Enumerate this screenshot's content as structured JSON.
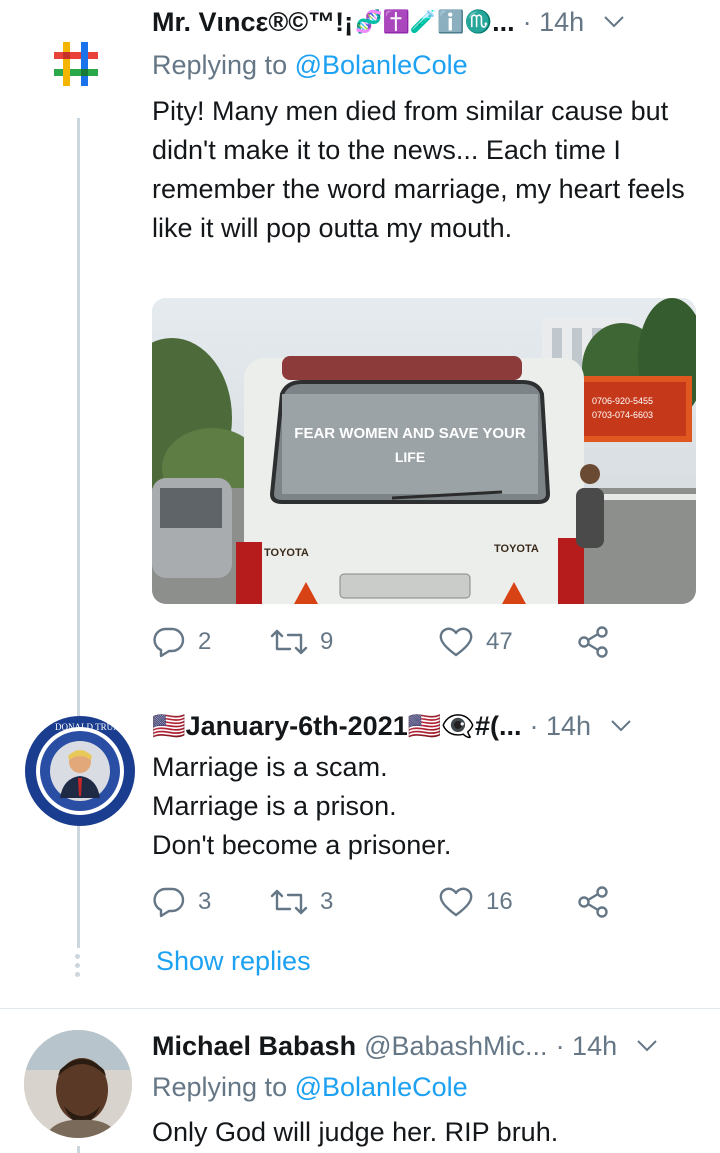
{
  "tweets": [
    {
      "name": "Mr. Vιncε®©™!¡",
      "name_emoji": "🧬✝️🧪ℹ️♏",
      "name_ellipsis": "...",
      "time": "· 14h",
      "replying_label": "Replying to",
      "replying_mention": "@BolanleCole",
      "text": "Pity! Many men died from similar cause but didn't make it to the news... Each time I remember the word marriage, my heart feels like it will pop outta my mouth.",
      "photo": {
        "sign_text_line1": "FEAR WOMEN AND SAVE YOUR",
        "sign_text_line2": "LIFE",
        "brand_left": "TOYOTA",
        "brand_right": "TOYOTA",
        "billboard_line1": "0706-920-5455",
        "billboard_line2": "0703-074-6603"
      },
      "replies": "2",
      "retweets": "9",
      "likes": "47"
    },
    {
      "name": "🇺🇸January-6th-2021🇺🇸👁‍🗨#(...",
      "time": "· 14h",
      "avatar_ring_text": "DONALD TRUMP",
      "text": "Marriage is a scam.\nMarriage is a prison.\nDon't become a prisoner.",
      "replies": "3",
      "retweets": "3",
      "likes": "16",
      "show_replies": "Show replies"
    },
    {
      "name": "Michael Babash",
      "handle": "@BabashMic...",
      "time": "· 14h",
      "replying_label": "Replying to",
      "replying_mention": "@BolanleCole",
      "text": "Only God will judge her. RIP bruh."
    }
  ],
  "colors": {
    "text": "#14171a",
    "secondary": "#657786",
    "accent": "#1da1f2",
    "thread_line": "#ccd6dd"
  },
  "icons": [
    "hashtag-avatar-icon",
    "chevron-down-icon",
    "reply-icon",
    "retweet-icon",
    "like-icon",
    "share-icon"
  ]
}
